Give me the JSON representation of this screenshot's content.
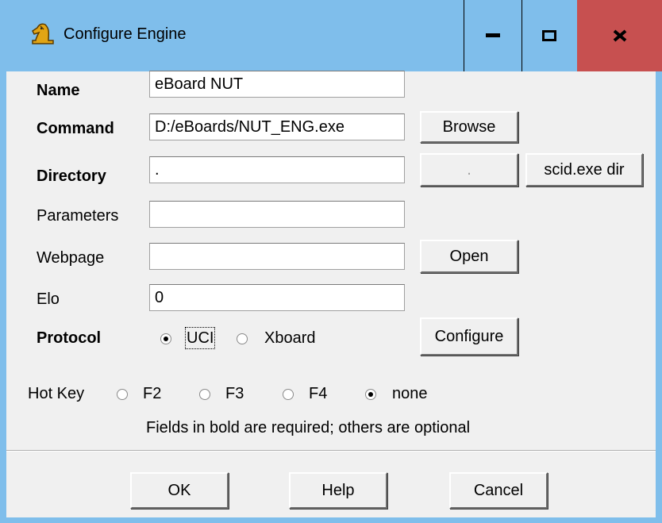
{
  "window": {
    "title": "Configure Engine",
    "icon": "chess-knight-icon"
  },
  "titlebar_buttons": {
    "minimize": "minimize-icon",
    "maximize": "maximize-icon",
    "close": "close-icon"
  },
  "form": {
    "name_label": "Name",
    "name_value": "eBoard NUT",
    "command_label": "Command",
    "command_value": "D:/eBoards/NUT_ENG.exe",
    "browse_label": "Browse",
    "directory_label": "Directory",
    "directory_value": ".",
    "directory_dot_button": ".",
    "scid_dir_button": "scid.exe dir",
    "parameters_label": "Parameters",
    "parameters_value": "",
    "webpage_label": "Webpage",
    "webpage_value": "",
    "open_label": "Open",
    "elo_label": "Elo",
    "elo_value": "0",
    "protocol_label": "Protocol",
    "protocol_options": [
      "UCI",
      "Xboard"
    ],
    "protocol_selected": "UCI",
    "configure_label": "Configure"
  },
  "hotkey": {
    "label": "Hot Key",
    "options": [
      "F2",
      "F3",
      "F4",
      "none"
    ],
    "selected": "none"
  },
  "note": "Fields in bold are required; others are optional",
  "footer": {
    "ok": "OK",
    "help": "Help",
    "cancel": "Cancel"
  }
}
